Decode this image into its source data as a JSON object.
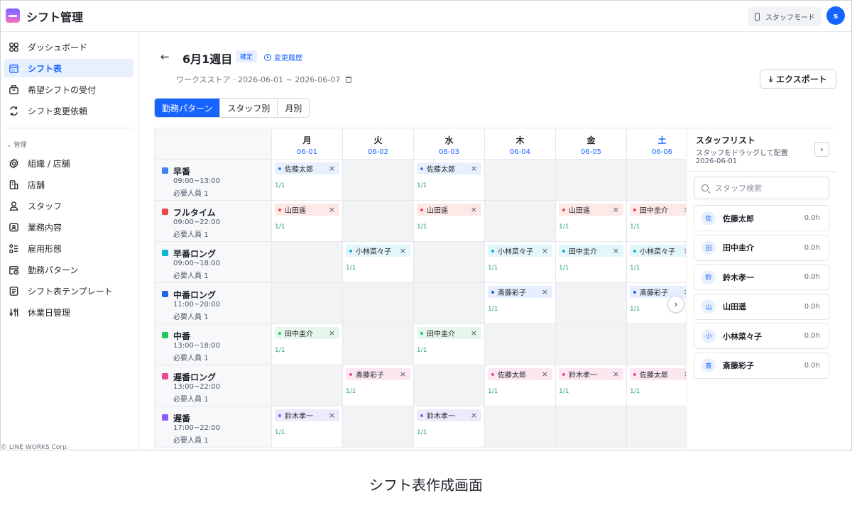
{
  "app": {
    "title": "シフト管理",
    "mode_button": "スタッフモード",
    "avatar_initial": "s"
  },
  "sidebar": {
    "items": [
      {
        "label": "ダッシュボード",
        "icon": "dashboard-grid-icon"
      },
      {
        "label": "シフト表",
        "icon": "calendar-icon",
        "active": true
      },
      {
        "label": "希望シフトの受付",
        "icon": "inbox-icon"
      },
      {
        "label": "シフト変更依頼",
        "icon": "swap-icon"
      }
    ],
    "section_label": "管理",
    "admin_items": [
      {
        "label": "組織 / 店舗",
        "icon": "gear-icon"
      },
      {
        "label": "店舗",
        "icon": "building-icon"
      },
      {
        "label": "スタッフ",
        "icon": "person-icon"
      },
      {
        "label": "業務内容",
        "icon": "id-card-icon"
      },
      {
        "label": "雇用形態",
        "icon": "list-icon"
      },
      {
        "label": "勤務パターン",
        "icon": "calendar-clock-icon"
      },
      {
        "label": "シフト表テンプレート",
        "icon": "document-icon"
      },
      {
        "label": "休業日管理",
        "icon": "sliders-icon"
      }
    ],
    "footer": "© LINE WORKS Corp."
  },
  "header": {
    "title": "6月1週目",
    "status_badge": "確定",
    "history_link": "変更履歴",
    "subline": "ワークスストア · 2026-06-01 ~ 2026-06-07",
    "export_label": "エクスポート"
  },
  "tabs": [
    {
      "label": "勤務パターン",
      "active": true
    },
    {
      "label": "スタッフ別"
    },
    {
      "label": "月別"
    }
  ],
  "days": [
    {
      "name": "月",
      "date": "06-01"
    },
    {
      "name": "火",
      "date": "06-02"
    },
    {
      "name": "水",
      "date": "06-03"
    },
    {
      "name": "木",
      "date": "06-04"
    },
    {
      "name": "金",
      "date": "06-05"
    },
    {
      "name": "土",
      "date": "06-06",
      "saturday": true
    }
  ],
  "patterns": [
    {
      "name": "早番",
      "time": "09:00~13:00",
      "required": "必要人員 1",
      "color": "#3b82f6",
      "chip_bg": "#e8f0fe",
      "cells": [
        "佐藤太郎",
        null,
        "佐藤太郎",
        null,
        null,
        null
      ]
    },
    {
      "name": "フルタイム",
      "time": "09:00~22:00",
      "required": "必要人員 1",
      "color": "#ef4444",
      "chip_bg": "#fde8e8",
      "cells": [
        "山田遥",
        null,
        "山田遥",
        null,
        "山田遥",
        "田中圭介"
      ]
    },
    {
      "name": "早番ロング",
      "time": "09:00~18:00",
      "required": "必要人員 1",
      "color": "#06b6d4",
      "chip_bg": "#e3f6fa",
      "cells": [
        null,
        "小林菜々子",
        null,
        "小林菜々子",
        "田中圭介",
        "小林菜々子"
      ]
    },
    {
      "name": "中番ロング",
      "time": "11:00~20:00",
      "required": "必要人員 1",
      "color": "#2563eb",
      "chip_bg": "#e6edfc",
      "cells": [
        null,
        null,
        null,
        "斎藤彩子",
        null,
        "斎藤彩子"
      ]
    },
    {
      "name": "中番",
      "time": "13:00~18:00",
      "required": "必要人員 1",
      "color": "#22c55e",
      "chip_bg": "#e6f6ea",
      "cells": [
        "田中圭介",
        null,
        "田中圭介",
        null,
        null,
        null
      ]
    },
    {
      "name": "遅番ロング",
      "time": "13:00~22:00",
      "required": "必要人員 1",
      "color": "#ec4899",
      "chip_bg": "#fce7f1",
      "cells": [
        null,
        "斎藤彩子",
        null,
        "佐藤太郎",
        "鈴木孝一",
        "佐藤太郎"
      ]
    },
    {
      "name": "遅番",
      "time": "17:00~22:00",
      "required": "必要人員 1",
      "color": "#8b5cf6",
      "chip_bg": "#efe9fc",
      "cells": [
        "鈴木孝一",
        null,
        "鈴木孝一",
        null,
        null,
        null
      ]
    }
  ],
  "count_label": "1/1",
  "staff_panel": {
    "title": "スタッフリスト",
    "hint": "スタッフをドラッグして配置",
    "date": "2026-06-01",
    "search_placeholder": "スタッフ検索",
    "staff": [
      {
        "initial": "佐",
        "name": "佐藤太郎",
        "hours": "0.0h"
      },
      {
        "initial": "田",
        "name": "田中圭介",
        "hours": "0.0h"
      },
      {
        "initial": "鈴",
        "name": "鈴木孝一",
        "hours": "0.0h"
      },
      {
        "initial": "山",
        "name": "山田遥",
        "hours": "0.0h"
      },
      {
        "initial": "小",
        "name": "小林菜々子",
        "hours": "0.0h"
      },
      {
        "initial": "斎",
        "name": "斎藤彩子",
        "hours": "0.0h"
      }
    ]
  },
  "caption": "シフト表作成画面"
}
